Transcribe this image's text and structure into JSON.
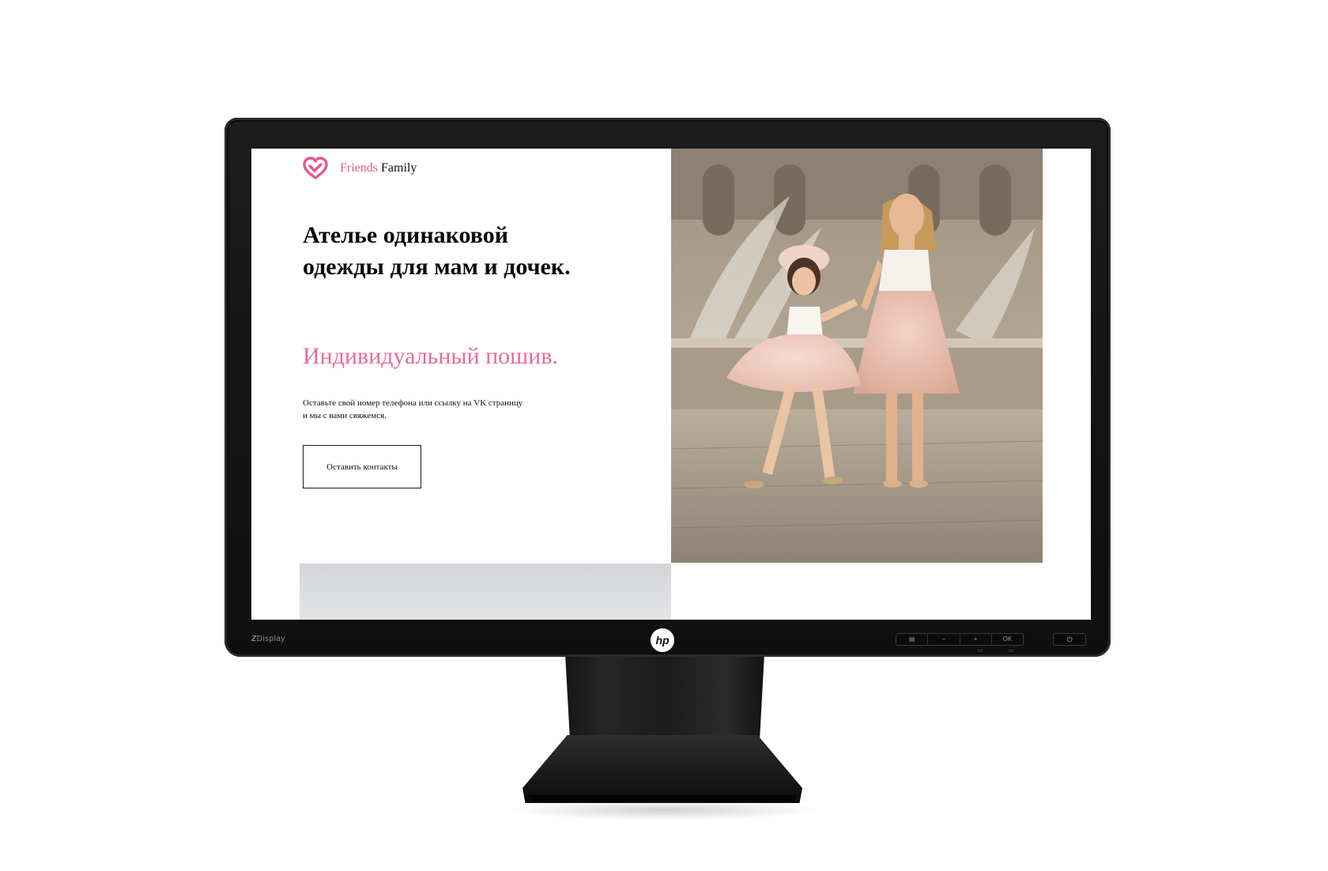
{
  "monitor": {
    "brand_prefix": "Z",
    "brand_name": "Display",
    "logo": "hp",
    "controls": [
      "▤",
      "−",
      "+",
      "OK"
    ],
    "power_icon": "⏻"
  },
  "site": {
    "logo": {
      "word_pink": "Friends",
      "word_dark": "Family"
    },
    "hero": {
      "title": "Ателье одинаковой одежды для мам и дочек.",
      "subtitle": "Индивидуальный пошив.",
      "description": "Оставьте свой номер телефона или ссылку на VK страницу и мы с вами свяжемся.",
      "cta_label": "Оставить контакты"
    },
    "colors": {
      "accent_pink": "#e4588f",
      "subtitle_pink": "#ea6a9b",
      "text_dark": "#0a0a0a"
    }
  }
}
